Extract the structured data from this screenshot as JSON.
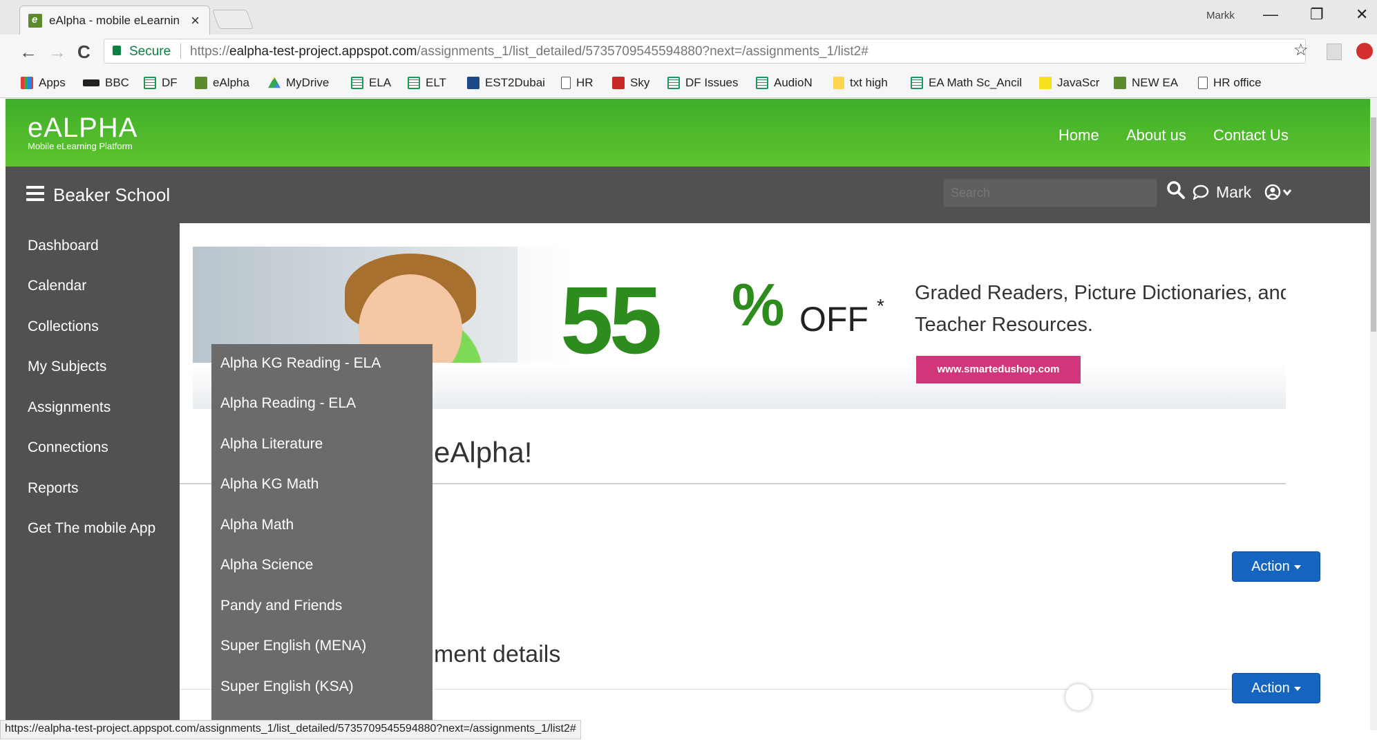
{
  "browser": {
    "tab_title": "eAlpha - mobile eLearnin",
    "tab_close": "×",
    "profile_name": "Markk",
    "minimize": "—",
    "restore": "❐",
    "close": "✕",
    "back": "←",
    "forward": "→",
    "reload": "C",
    "secure_label": "Secure",
    "url_scheme": "https://",
    "url_host": "ealpha-test-project.appspot.com",
    "url_path": "/assignments_1/list_detailed/5735709545594880?next=/assignments_1/list2#",
    "star": "☆",
    "bookmarks": [
      {
        "label": "Apps",
        "icon": "apps-icon"
      },
      {
        "label": "BBC",
        "icon": "bbc-icon"
      },
      {
        "label": "DF",
        "icon": "sheets-icon"
      },
      {
        "label": "eAlpha",
        "icon": "ealpha-icon"
      },
      {
        "label": "MyDrive",
        "icon": "drive-icon"
      },
      {
        "label": "ELA",
        "icon": "sheets-icon"
      },
      {
        "label": "ELT",
        "icon": "sheets-icon"
      },
      {
        "label": "EST2Dubai",
        "icon": "est-icon"
      },
      {
        "label": "HR",
        "icon": "doc-icon"
      },
      {
        "label": "Sky",
        "icon": "sky-icon"
      },
      {
        "label": "DF Issues",
        "icon": "sheets-icon"
      },
      {
        "label": "AudioN",
        "icon": "sheets-icon"
      },
      {
        "label": "txt high",
        "icon": "folder-icon"
      },
      {
        "label": "EA Math Sc_Ancil",
        "icon": "sheets-icon"
      },
      {
        "label": "JavaScr",
        "icon": "js-icon"
      },
      {
        "label": "NEW EA",
        "icon": "ealpha-icon"
      },
      {
        "label": "HR office",
        "icon": "doc-icon"
      }
    ],
    "status_url": "https://ealpha-test-project.appspot.com/assignments_1/list_detailed/5735709545594880?next=/assignments_1/list2#"
  },
  "site": {
    "logo_main": "eALPHA",
    "logo_sub": "Mobile eLearning Platform",
    "nav": [
      "Home",
      "About us",
      "Contact Us"
    ],
    "school_name": "Beaker School",
    "search_placeholder": "Search",
    "user_name": "Mark"
  },
  "sidebar": {
    "items": [
      "Dashboard",
      "Calendar",
      "Collections",
      "My Subjects",
      "Assignments",
      "Connections",
      "Reports",
      "Get The mobile App"
    ]
  },
  "subjects_menu": {
    "items": [
      "Alpha KG Reading - ELA",
      "Alpha Reading - ELA",
      "Alpha Literature",
      "Alpha KG Math",
      "Alpha Math",
      "Alpha Science",
      "Pandy and Friends",
      "Super English (MENA)",
      "Super English (KSA)"
    ]
  },
  "banner": {
    "discount_number": "55",
    "discount_percent": "%",
    "discount_off": "OFF",
    "asterisk": "*",
    "headline": "Graded Readers, Picture Dictionaries, and Teacher Resources.",
    "button_label": "www.smartedushop.com"
  },
  "main": {
    "welcome_fragment": "eAlpha!",
    "section_fragment": "ment details",
    "action_label": "Action"
  },
  "colors": {
    "header_green": "#4cb82b",
    "appbar_gray": "#515151",
    "action_blue": "#1565c0",
    "promo_pink": "#d1357a",
    "promo_green": "#2e8b1e"
  }
}
